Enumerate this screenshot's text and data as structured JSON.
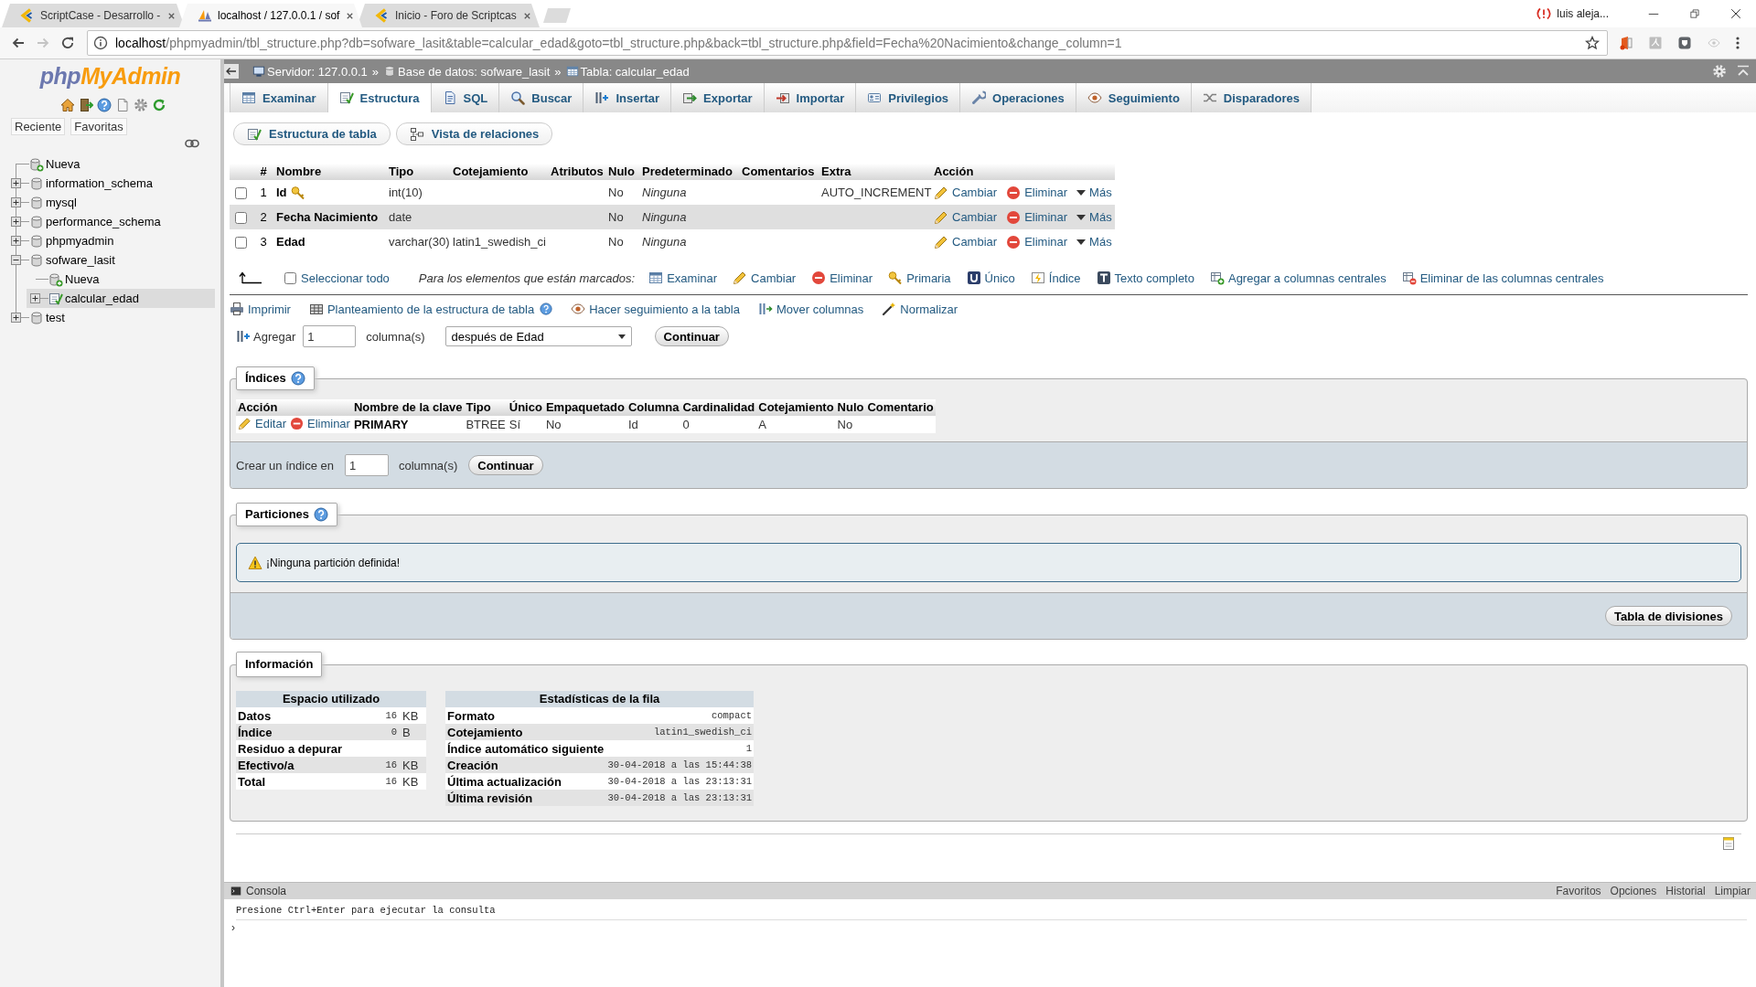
{
  "browser": {
    "tabs": [
      {
        "title": "ScriptCase - Desarrollo -",
        "selected": false
      },
      {
        "title": "localhost / 127.0.0.1 / sof",
        "selected": true
      },
      {
        "title": "Inicio - Foro de Scriptcas",
        "selected": false
      }
    ],
    "profile": "luis aleja...",
    "url": {
      "host": "localhost",
      "path": "/phpmyadmin/tbl_structure.php?db=sofware_lasit&table=calcular_edad&goto=tbl_structure.php&back=tbl_structure.php&field=Fecha%20Nacimiento&change_column=1"
    }
  },
  "sidebar": {
    "logo": {
      "prefix": "php",
      "suffix": "MyAdmin"
    },
    "buttons": [
      "Reciente",
      "Favoritas"
    ],
    "tree": [
      {
        "label": "Nueva",
        "kind": "new",
        "selected": false
      },
      {
        "label": "information_schema",
        "kind": "database",
        "expanded": false,
        "selected": false
      },
      {
        "label": "mysql",
        "kind": "database",
        "expanded": false,
        "selected": false
      },
      {
        "label": "performance_schema",
        "kind": "database",
        "expanded": false,
        "selected": false
      },
      {
        "label": "phpmyadmin",
        "kind": "database",
        "expanded": false,
        "selected": false
      },
      {
        "label": "sofware_lasit",
        "kind": "database",
        "expanded": true,
        "selected": false,
        "children": [
          {
            "label": "Nueva",
            "kind": "new",
            "selected": false
          },
          {
            "label": "calcular_edad",
            "kind": "table",
            "expanded": false,
            "selected": true
          }
        ]
      },
      {
        "label": "test",
        "kind": "database",
        "expanded": false,
        "selected": false
      }
    ]
  },
  "breadcrumb": [
    {
      "kind": "server",
      "label": "Servidor: 127.0.0.1"
    },
    {
      "kind": "separator",
      "label": "»"
    },
    {
      "kind": "database",
      "label": "Base de datos: sofware_lasit"
    },
    {
      "kind": "separator",
      "label": "»"
    },
    {
      "kind": "table",
      "label": "Tabla: calcular_edad"
    }
  ],
  "nav_tabs": [
    {
      "label": "Examinar",
      "selected": false
    },
    {
      "label": "Estructura",
      "selected": true
    },
    {
      "label": "SQL",
      "selected": false
    },
    {
      "label": "Buscar",
      "selected": false
    },
    {
      "label": "Insertar",
      "selected": false
    },
    {
      "label": "Exportar",
      "selected": false
    },
    {
      "label": "Importar",
      "selected": false
    },
    {
      "label": "Privilegios",
      "selected": false
    },
    {
      "label": "Operaciones",
      "selected": false
    },
    {
      "label": "Seguimiento",
      "selected": false
    },
    {
      "label": "Disparadores",
      "selected": false
    }
  ],
  "sub_tabs": [
    "Estructura de tabla",
    "Vista de relaciones"
  ],
  "structure": {
    "columns": [
      "#",
      "Nombre",
      "Tipo",
      "Cotejamiento",
      "Atributos",
      "Nulo",
      "Predeterminado",
      "Comentarios",
      "Extra",
      "Acción"
    ],
    "rows": [
      {
        "checked": false,
        "number": "1",
        "name": "Id",
        "primary": true,
        "type": "int(10)",
        "null": "No",
        "default": "Ninguna",
        "extra": "AUTO_INCREMENT",
        "actions": [
          "Cambiar",
          "Eliminar",
          "Más"
        ]
      },
      {
        "checked": false,
        "number": "2",
        "name": "Fecha Nacimiento",
        "primary": false,
        "type": "date",
        "null": "No",
        "default": "Ninguna",
        "actions": [
          "Cambiar",
          "Eliminar",
          "Más"
        ]
      },
      {
        "checked": false,
        "number": "3",
        "name": "Edad",
        "primary": false,
        "type": "varchar(30)",
        "collation": "latin1_swedish_ci",
        "null": "No",
        "default": "Ninguna",
        "actions": [
          "Cambiar",
          "Eliminar",
          "Más"
        ]
      }
    ]
  },
  "bulk": {
    "select_all": {
      "label": "Seleccionar todo",
      "checked": false
    },
    "hint": "Para los elementos que están marcados:",
    "actions": [
      "Examinar",
      "Cambiar",
      "Eliminar",
      "Primaria",
      "Único",
      "Índice",
      "Texto completo",
      "Agregar a columnas centrales",
      "Eliminar de las columnas centrales"
    ]
  },
  "links": [
    {
      "label": "Imprimir",
      "help": false
    },
    {
      "label": "Planteamiento de la estructura de tabla",
      "help": true
    },
    {
      "label": "Hacer seguimiento a la tabla",
      "help": false
    },
    {
      "label": "Mover columnas",
      "help": false
    },
    {
      "label": "Normalizar",
      "help": false
    }
  ],
  "add_columns": {
    "label": "Agregar",
    "value": "1",
    "unit": "columna(s)",
    "position": "después de Edad",
    "button": "Continuar"
  },
  "indexes": {
    "legend": {
      "title": "Índices",
      "help": true
    },
    "columns": [
      "Acción",
      "Nombre de la clave",
      "Tipo",
      "Único",
      "Empaquetado",
      "Columna",
      "Cardinalidad",
      "Cotejamiento",
      "Nulo",
      "Comentario"
    ],
    "rows": [
      {
        "actions": [
          "Editar",
          "Eliminar"
        ],
        "key_name": "PRIMARY",
        "type": "BTREE",
        "unique": "Sí",
        "packed": "No",
        "column": "Id",
        "cardinality": "0",
        "collation": "A",
        "null": "No"
      }
    ],
    "create": {
      "label": "Crear un índice en",
      "value": "1",
      "unit": "columna(s)",
      "button": "Continuar"
    }
  },
  "partitions": {
    "legend": {
      "title": "Particiones",
      "help": true
    },
    "notice": "¡Ninguna partición definida!",
    "button": "Tabla de divisiones"
  },
  "information": {
    "legend": {
      "title": "Información",
      "help": false
    },
    "space": {
      "title": "Espacio utilizado",
      "rows": [
        {
          "label": "Datos",
          "value": "16",
          "unit": "KB"
        },
        {
          "label": "Índice",
          "value": "0",
          "unit": "B"
        },
        {
          "label": "Residuo a depurar"
        },
        {
          "label": "Efectivo/a",
          "value": "16",
          "unit": "KB"
        },
        {
          "label": "Total",
          "value": "16",
          "unit": "KB"
        }
      ]
    },
    "row_stats": {
      "title": "Estadísticas de la fila",
      "rows": [
        {
          "label": "Formato",
          "value": "compact"
        },
        {
          "label": "Cotejamiento",
          "value": "latin1_swedish_ci"
        },
        {
          "label": "Índice automático siguiente",
          "value": "1"
        },
        {
          "label": "Creación",
          "value": "30-04-2018 a las 15:44:38"
        },
        {
          "label": "Última actualización",
          "value": "30-04-2018 a las 23:13:31"
        },
        {
          "label": "Última revisión",
          "value": "30-04-2018 a las 23:13:31"
        }
      ]
    }
  },
  "console": {
    "title": "Consola",
    "links": [
      "Favoritos",
      "Opciones",
      "Historial",
      "Limpiar"
    ],
    "hint": "Presione Ctrl+Enter para ejecutar la consulta",
    "prompt": "›"
  }
}
